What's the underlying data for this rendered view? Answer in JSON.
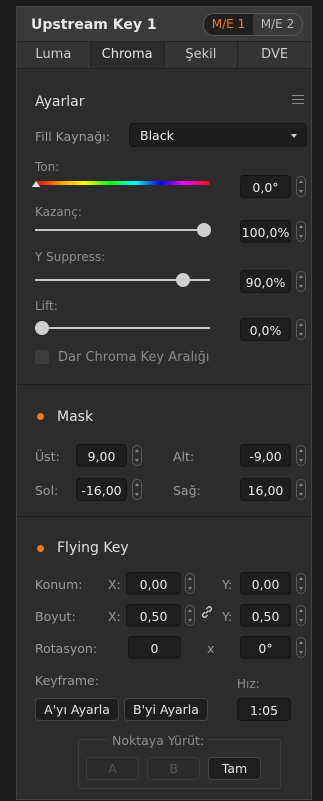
{
  "header": {
    "title": "Upstream Key 1",
    "me_buttons": [
      "M/E 1",
      "M/E 2"
    ]
  },
  "tabs": [
    "Luma",
    "Chroma",
    "Şekil",
    "DVE"
  ],
  "settings": {
    "title": "Ayarlar",
    "fill_label": "Fill Kaynağı:",
    "fill_value": "Black",
    "hue": {
      "label": "Ton:",
      "value": "0,0°",
      "level": 0
    },
    "gain": {
      "label": "Kazanç:",
      "value": "100,0%",
      "level": 1.0
    },
    "ysuppress": {
      "label": "Y Suppress:",
      "value": "90,0%",
      "level": 0.9
    },
    "lift": {
      "label": "Lift:",
      "value": "0,0%",
      "level": 0
    },
    "narrow_checkbox_label": "Dar Chroma Key Aralığı"
  },
  "mask": {
    "title": "Mask",
    "top_label": "Üst:",
    "top_value": "9,00",
    "bottom_label": "Alt:",
    "bottom_value": "-9,00",
    "left_label": "Sol:",
    "left_value": "-16,00",
    "right_label": "Sağ:",
    "right_value": "16,00"
  },
  "flying_key": {
    "title": "Flying Key",
    "position_label": "Konum:",
    "pos_x_label": "X:",
    "pos_x": "0,00",
    "pos_y_label": "Y:",
    "pos_y": "0,00",
    "size_label": "Boyut:",
    "size_x_label": "X:",
    "size_x": "0,50",
    "size_y_label": "Y:",
    "size_y": "0,50",
    "rotation_label": "Rotasyon:",
    "rotation_turns": "0",
    "rotation_x": "x",
    "rotation_degrees": "0°",
    "keyframe_label": "Keyframe:",
    "speed_label": "Hız:",
    "set_a": "A'yı Ayarla",
    "set_b": "B'yi Ayarla",
    "speed_value": "1:05",
    "run_to_label": "Noktaya Yürüt:",
    "run_a": "A",
    "run_b": "B",
    "run_full": "Tam"
  },
  "colors": {
    "accent": "#f07a18",
    "panel_bg": "#2c2c2c",
    "field_bg": "#1e1e1e"
  }
}
